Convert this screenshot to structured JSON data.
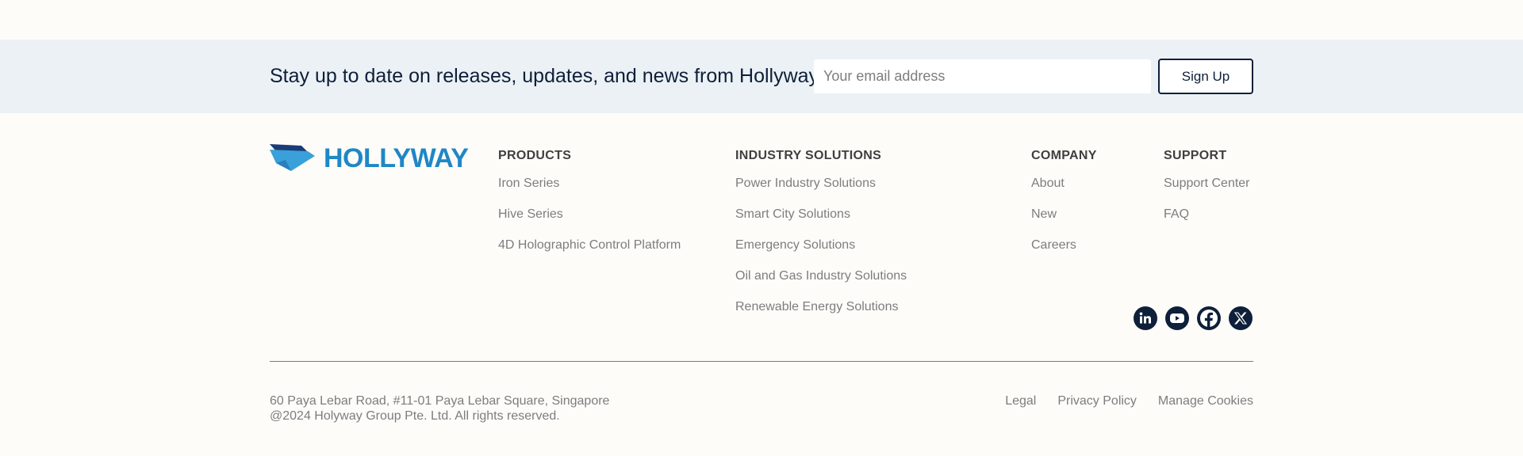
{
  "newsletter": {
    "text": "Stay up to date on releases, updates, and news from Hollyway:",
    "email_placeholder": "Your email address",
    "signup_label": "Sign Up"
  },
  "logo": {
    "text": "HOLLYWAY",
    "icon": "hollyway-logo-mark",
    "color": "#1f87c6"
  },
  "columns": {
    "products": {
      "heading": "PRODUCTS",
      "items": [
        "Iron Series",
        "Hive Series",
        "4D Holographic Control Platform"
      ]
    },
    "industry": {
      "heading": "INDUSTRY SOLUTIONS",
      "items": [
        "Power Industry Solutions",
        "Smart City Solutions",
        "Emergency Solutions",
        "Oil and Gas Industry Solutions",
        "Renewable Energy Solutions"
      ]
    },
    "company": {
      "heading": "COMPANY",
      "items": [
        "About",
        "New",
        "Careers"
      ]
    },
    "support": {
      "heading": "SUPPORT",
      "items": [
        "Support Center",
        "FAQ"
      ]
    }
  },
  "social": {
    "icons": [
      "linkedin-icon",
      "youtube-icon",
      "facebook-icon",
      "x-icon"
    ],
    "color": "#0e1f3a"
  },
  "footer": {
    "address": "60 Paya Lebar Road, #11-01 Paya Lebar Square, Singapore",
    "copyright": "@2024 Holyway Group Pte. Ltd. All rights reserved.",
    "links": [
      "Legal",
      "Privacy Policy",
      "Manage Cookies"
    ]
  },
  "colors": {
    "background": "#fdfcf9",
    "newsletter_band": "#ebf1f5",
    "navy": "#0e1f3a",
    "muted_text": "#7d7d7d"
  }
}
